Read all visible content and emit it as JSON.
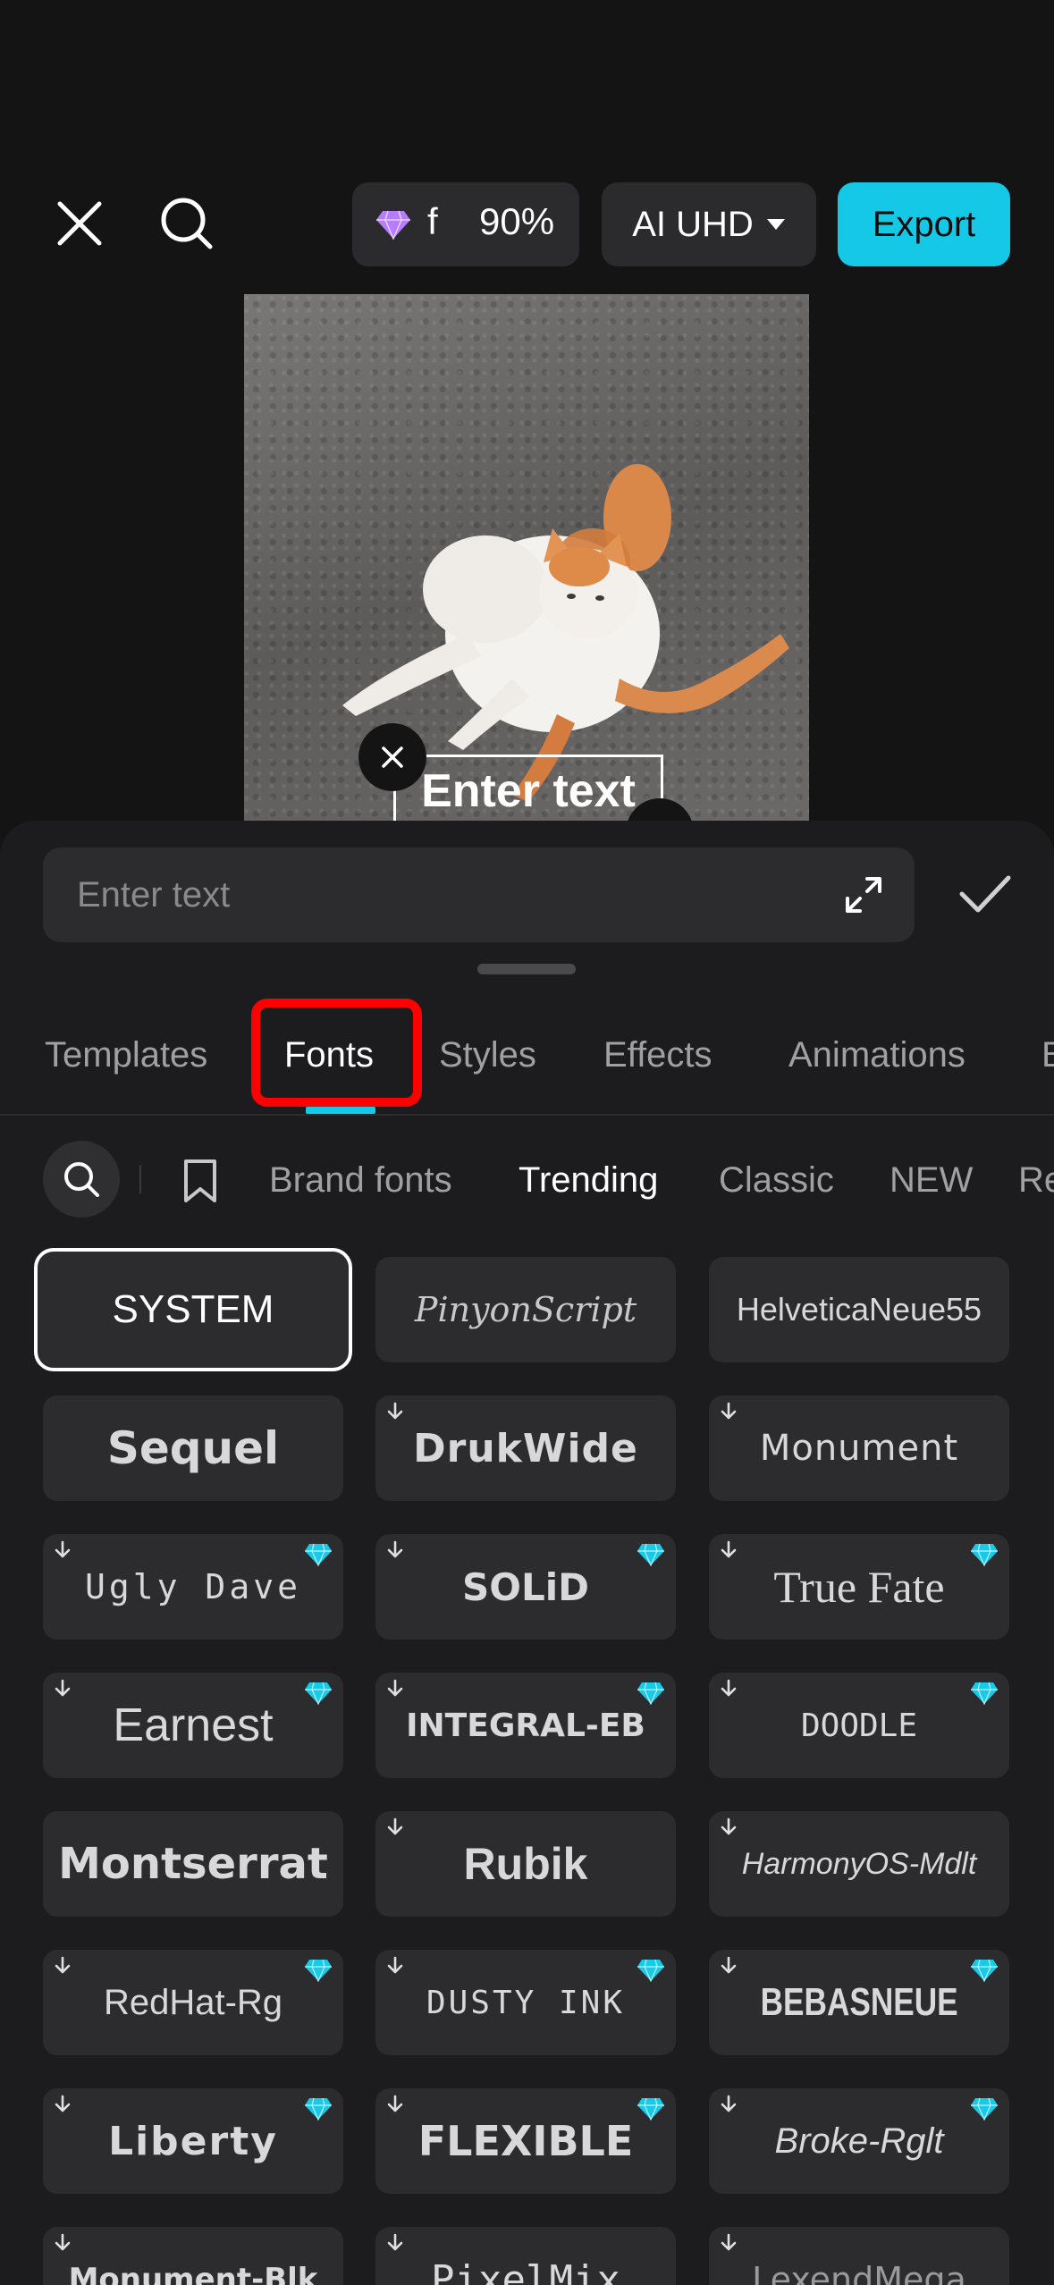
{
  "topbar": {
    "credits_label": "f",
    "credits_value": "90%",
    "quality_label": "AI UHD",
    "export_label": "Export",
    "accent_color": "#14c8e6"
  },
  "preview": {
    "overlay_text": "Enter text"
  },
  "editor": {
    "text_placeholder": "Enter text",
    "tabs": [
      "Templates",
      "Fonts",
      "Styles",
      "Effects",
      "Animations",
      "B"
    ],
    "active_tab": "Fonts",
    "categories": [
      "Brand fonts",
      "Trending",
      "Classic",
      "NEW",
      "Re"
    ],
    "active_category": "Trending"
  },
  "fonts": [
    {
      "name": "SYSTEM",
      "selected": true,
      "download": false,
      "premium": false
    },
    {
      "name": "PinyonScript",
      "download": false,
      "premium": false
    },
    {
      "name": "HelveticaNeue55",
      "download": false,
      "premium": false
    },
    {
      "name": "Sequel",
      "download": false,
      "premium": false
    },
    {
      "name": "DrukWide",
      "download": true,
      "premium": false
    },
    {
      "name": "Monument",
      "download": true,
      "premium": false
    },
    {
      "name": "Ugly Dave",
      "download": true,
      "premium": true
    },
    {
      "name": "SOLiD",
      "download": true,
      "premium": true
    },
    {
      "name": "True Fate",
      "download": true,
      "premium": true
    },
    {
      "name": "Earnest",
      "download": true,
      "premium": true
    },
    {
      "name": "INTEGRAL-EB",
      "download": true,
      "premium": true
    },
    {
      "name": "DOODLE",
      "download": true,
      "premium": true
    },
    {
      "name": "Montserrat",
      "download": false,
      "premium": false
    },
    {
      "name": "Rubik",
      "download": true,
      "premium": false
    },
    {
      "name": "HarmonyOS-Mdlt",
      "download": true,
      "premium": false
    },
    {
      "name": "RedHat-Rg",
      "download": true,
      "premium": true
    },
    {
      "name": "DUSTY INK",
      "download": true,
      "premium": true
    },
    {
      "name": "BEBASNEUE",
      "download": true,
      "premium": true
    },
    {
      "name": "Liberty",
      "download": true,
      "premium": true
    },
    {
      "name": "FLEXIBLE",
      "download": true,
      "premium": true
    },
    {
      "name": "Broke-Rglt",
      "download": true,
      "premium": true
    },
    {
      "name": "Monument-Blk",
      "download": true,
      "premium": false
    },
    {
      "name": "PixelMix",
      "download": true,
      "premium": false
    },
    {
      "name": "LexendMega",
      "download": true,
      "premium": false
    }
  ]
}
